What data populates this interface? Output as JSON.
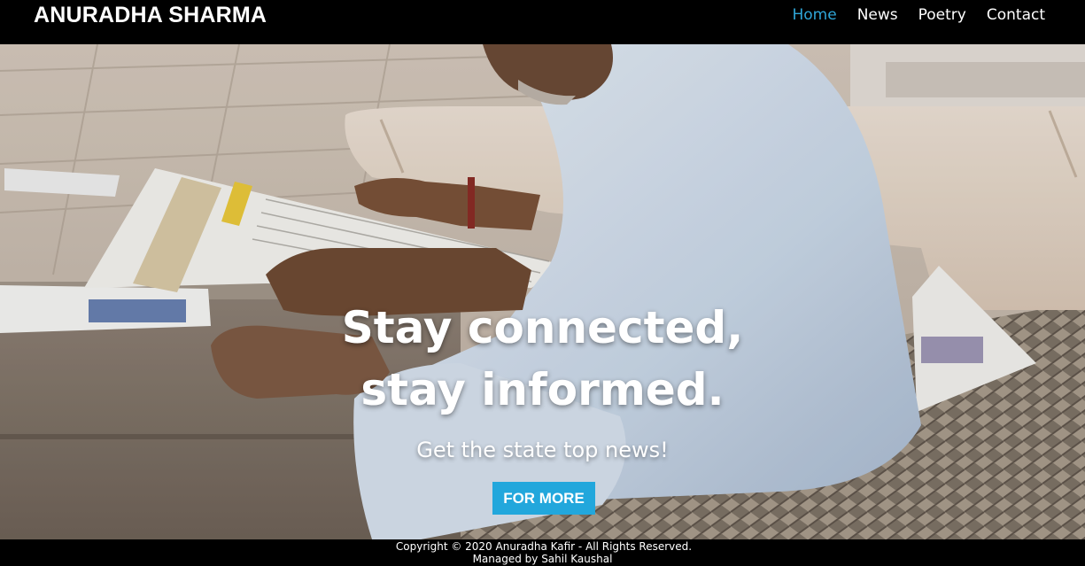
{
  "brand": "ANURADHA SHARMA",
  "nav": {
    "items": [
      {
        "label": "Home",
        "active": true
      },
      {
        "label": "News",
        "active": false
      },
      {
        "label": "Poetry",
        "active": false
      },
      {
        "label": "Contact",
        "active": false
      }
    ],
    "active_color": "#2fa6d8"
  },
  "hero": {
    "title_line1": "Stay connected,",
    "title_line2": "stay informed.",
    "subtitle": "Get the state top news!",
    "cta_label": "FOR MORE",
    "cta_color": "#22a7dc"
  },
  "footer": {
    "copyright": "Copyright © 2020 Anuradha Kafir - All Rights Reserved.",
    "managed": "Managed by Sahil Kaushal"
  }
}
